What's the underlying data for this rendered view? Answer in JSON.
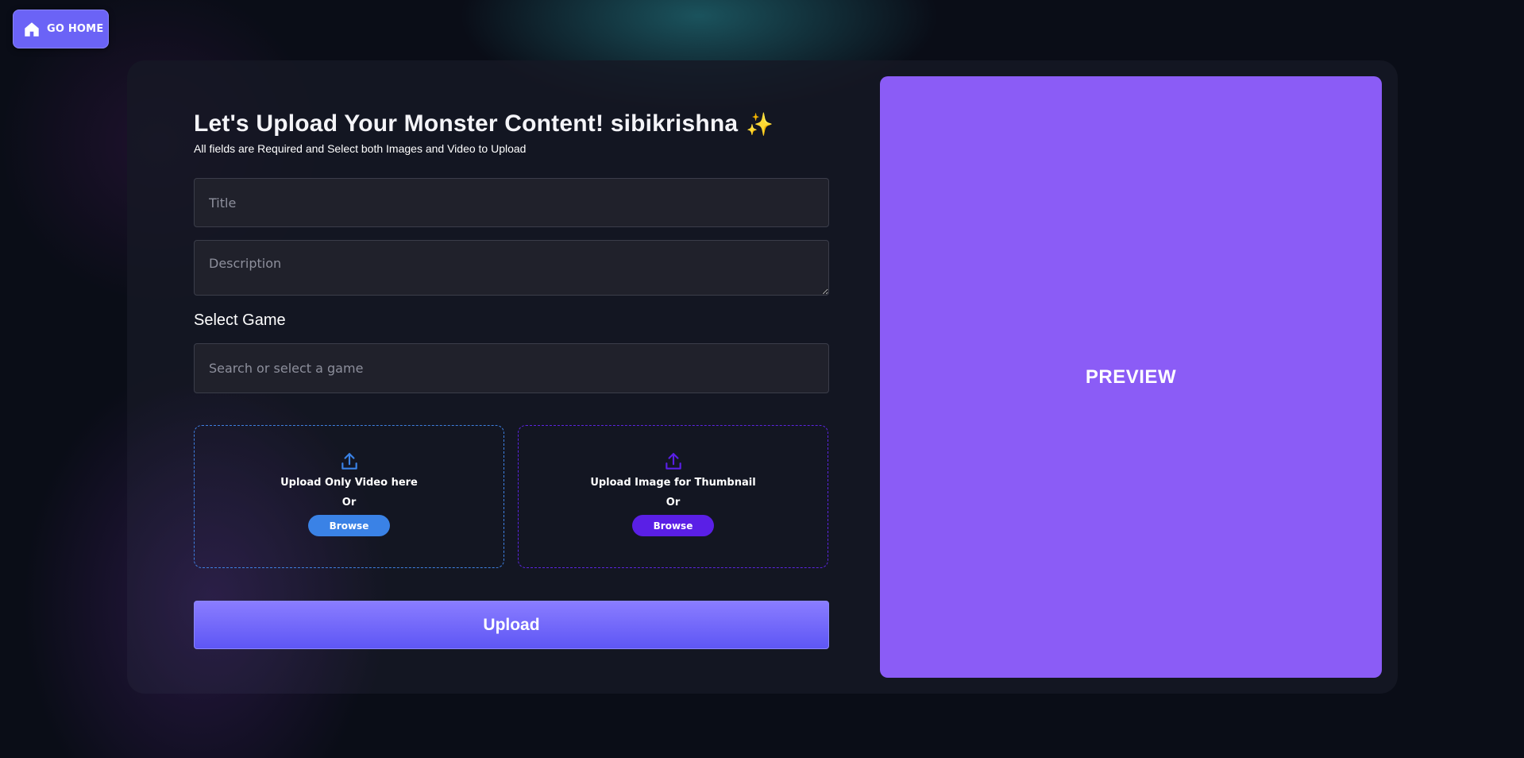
{
  "nav": {
    "home_label": "GO HOME",
    "home_icon": "home-icon"
  },
  "form": {
    "heading": "Let's Upload Your Monster Content! sibikrishna",
    "heading_emoji": "✨",
    "subheading": "All fields are Required and Select both Images and Video to Upload",
    "title_placeholder": "Title",
    "title_value": "",
    "description_placeholder": "Description",
    "description_value": "",
    "game_label": "Select Game",
    "game_placeholder": "Search or select a game",
    "game_value": ""
  },
  "upload_video": {
    "icon": "upload-icon",
    "text": "Upload Only Video here",
    "or": "Or",
    "browse_label": "Browse",
    "accent": "#3a82e6"
  },
  "upload_image": {
    "icon": "upload-icon",
    "text": "Upload Image for Thumbnail",
    "or": "Or",
    "browse_label": "Browse",
    "accent": "#5a1fe6"
  },
  "upload_button_label": "Upload",
  "preview": {
    "label": "PREVIEW",
    "background": "#8b5cf6"
  },
  "colors": {
    "background": "#0a0d17",
    "primary": "#6b63f6"
  }
}
